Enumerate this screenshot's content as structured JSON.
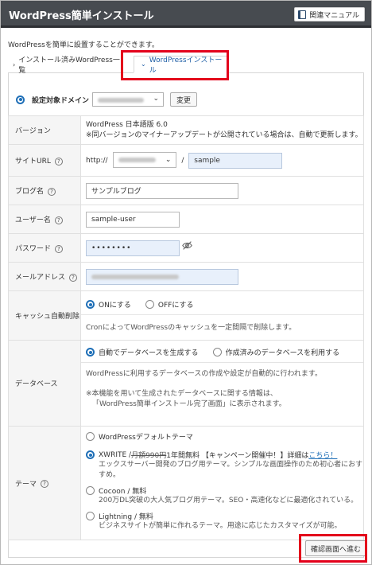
{
  "header": {
    "title": "WordPress簡単インストール",
    "manual_label": "関連マニュアル"
  },
  "intro": "WordPressを簡単に設置することができます。",
  "tabs": [
    {
      "label": "インストール済みWordPress一覧",
      "active": false
    },
    {
      "label": "WordPressインストール",
      "active": true
    }
  ],
  "domain": {
    "label": "設定対象ドメイン",
    "change_label": "変更"
  },
  "form": {
    "version": {
      "label": "バージョン",
      "value": "WordPress 日本語版 6.0",
      "note": "※同バージョンのマイナーアップデートが公開されている場合は、自動で更新します。"
    },
    "site_url": {
      "label": "サイトURL",
      "scheme": "http://",
      "slash": "/",
      "path": "sample"
    },
    "blog_name": {
      "label": "ブログ名",
      "value": "サンプルブログ"
    },
    "user_name": {
      "label": "ユーザー名",
      "value": "sample-user"
    },
    "password": {
      "label": "パスワード",
      "value": "••••••••"
    },
    "email": {
      "label": "メールアドレス"
    },
    "cache": {
      "label": "キャッシュ自動削除",
      "options": [
        "ONにする",
        "OFFにする"
      ],
      "selected": "ONにする",
      "note": "CronによってWordPressのキャッシュを一定間隔で削除します。"
    },
    "database": {
      "label": "データベース",
      "options": [
        "自動でデータベースを生成する",
        "作成済みのデータベースを利用する"
      ],
      "selected": "自動でデータベースを生成する",
      "note1": "WordPressに利用するデータベースの作成や設定が自動的に行われます。",
      "note2": "※本機能を用いて生成されたデータベースに関する情報は、",
      "note3": "「WordPress簡単インストール完了画面」に表示されます。"
    },
    "theme": {
      "label": "テーマ",
      "default_label": "WordPressデフォルトテーマ",
      "xwrite_name": "XWRITE / ",
      "xwrite_strike": "月額990円",
      "xwrite_rest": " 1年間無料 【キャンペーン開催中！】詳細は",
      "xwrite_link": "こちら！",
      "xwrite_desc": "エックスサーバー開発のブログ用テーマ。シンプルな画面操作のため初心者におすすめ。",
      "cocoon_name": "Cocoon / 無料",
      "cocoon_desc": "200万DL突破の大人気ブログ用テーマ。SEO・高速化などに最適化されている。",
      "lightning_name": "Lightning / 無料",
      "lightning_desc": "ビジネスサイトが簡単に作れるテーマ。用途に応じたカスタマイズが可能。"
    }
  },
  "confirm_label": "確認画面へ進む",
  "colors": {
    "header_bg": "#474b50",
    "accent": "#1f6fb7",
    "highlight": "#e3001b"
  }
}
